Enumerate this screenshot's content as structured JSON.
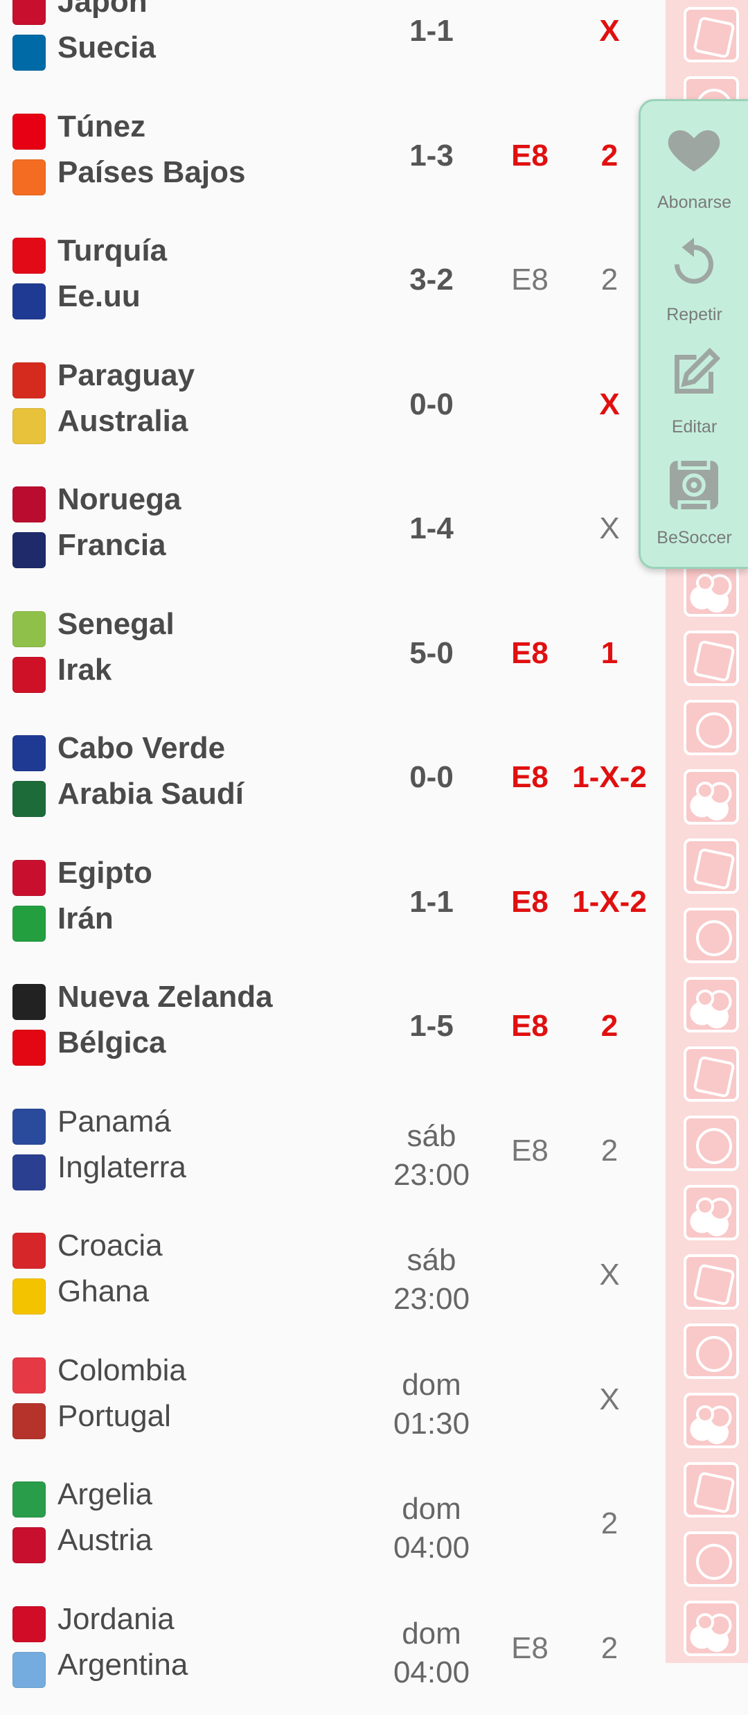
{
  "matches": [
    {
      "home": "Japón",
      "away": "Suecia",
      "result": "1-1",
      "pick": "X",
      "pick_red": true,
      "e8": "",
      "e8_red": false,
      "bold": true,
      "home_flag": "#c8102e",
      "away_flag": "#006aa7"
    },
    {
      "home": "Túnez",
      "away": "Países Bajos",
      "result": "1-3",
      "pick": "2",
      "pick_red": true,
      "e8": "E8",
      "e8_red": true,
      "bold": true,
      "home_flag": "#e70013",
      "away_flag": "#f36c21"
    },
    {
      "home": "Turquía",
      "away": "Ee.uu",
      "result": "3-2",
      "pick": "2",
      "pick_red": false,
      "e8": "E8",
      "e8_red": false,
      "bold": true,
      "home_flag": "#e30a17",
      "away_flag": "#1f3a93"
    },
    {
      "home": "Paraguay",
      "away": "Australia",
      "result": "0-0",
      "pick": "X",
      "pick_red": true,
      "e8": "",
      "e8_red": false,
      "bold": true,
      "home_flag": "#d52b1e",
      "away_flag": "#e7c23a"
    },
    {
      "home": "Noruega",
      "away": "Francia",
      "result": "1-4",
      "pick": "X",
      "pick_red": false,
      "e8": "",
      "e8_red": false,
      "bold": true,
      "home_flag": "#ba0c2f",
      "away_flag": "#1f2a6b"
    },
    {
      "home": "Senegal",
      "away": "Irak",
      "result": "5-0",
      "pick": "1",
      "pick_red": true,
      "e8": "E8",
      "e8_red": true,
      "bold": true,
      "home_flag": "#8fc14a",
      "away_flag": "#ce1126"
    },
    {
      "home": "Cabo Verde",
      "away": "Arabia Saudí",
      "result": "0-0",
      "pick": "1-X-2",
      "pick_red": true,
      "e8": "E8",
      "e8_red": true,
      "bold": true,
      "home_flag": "#1f3a93",
      "away_flag": "#1e6b3a"
    },
    {
      "home": "Egipto",
      "away": "Irán",
      "result": "1-1",
      "pick": "1-X-2",
      "pick_red": true,
      "e8": "E8",
      "e8_red": true,
      "bold": true,
      "home_flag": "#c8102e",
      "away_flag": "#239f40"
    },
    {
      "home": "Nueva Zelanda",
      "away": "Bélgica",
      "result": "1-5",
      "pick": "2",
      "pick_red": true,
      "e8": "E8",
      "e8_red": true,
      "bold": true,
      "home_flag": "#222222",
      "away_flag": "#e30613"
    },
    {
      "home": "Panamá",
      "away": "Inglaterra",
      "day": "sáb",
      "time": "23:00",
      "pick": "2",
      "pick_red": false,
      "e8": "E8",
      "e8_red": false,
      "bold": false,
      "home_flag": "#2a4a9c",
      "away_flag": "#2a3f8f"
    },
    {
      "home": "Croacia",
      "away": "Ghana",
      "day": "sáb",
      "time": "23:00",
      "pick": "X",
      "pick_red": false,
      "e8": "",
      "e8_red": false,
      "bold": false,
      "home_flag": "#d7262a",
      "away_flag": "#f4c300"
    },
    {
      "home": "Colombia",
      "away": "Portugal",
      "day": "dom",
      "time": "01:30",
      "pick": "X",
      "pick_red": false,
      "e8": "",
      "e8_red": false,
      "bold": false,
      "home_flag": "#e63946",
      "away_flag": "#b5332a"
    },
    {
      "home": "Argelia",
      "away": "Austria",
      "day": "dom",
      "time": "04:00",
      "pick": "2",
      "pick_red": false,
      "e8": "",
      "e8_red": false,
      "bold": false,
      "home_flag": "#2a9d4a",
      "away_flag": "#c8102e"
    },
    {
      "home": "Jordania",
      "away": "Argentina",
      "day": "dom",
      "time": "04:00",
      "pick": "2",
      "pick_red": false,
      "e8": "E8",
      "e8_red": false,
      "bold": false,
      "home_flag": "#d00c27",
      "away_flag": "#74acdf"
    }
  ],
  "menu": {
    "subscribe_label": "Abonarse",
    "repeat_label": "Repetir",
    "edit_label": "Editar",
    "besoccer_label": "BeSoccer"
  },
  "colors": {
    "accent_red": "#e01010",
    "menu_bg": "#c4eedb",
    "strip_bg": "#fbdada"
  }
}
